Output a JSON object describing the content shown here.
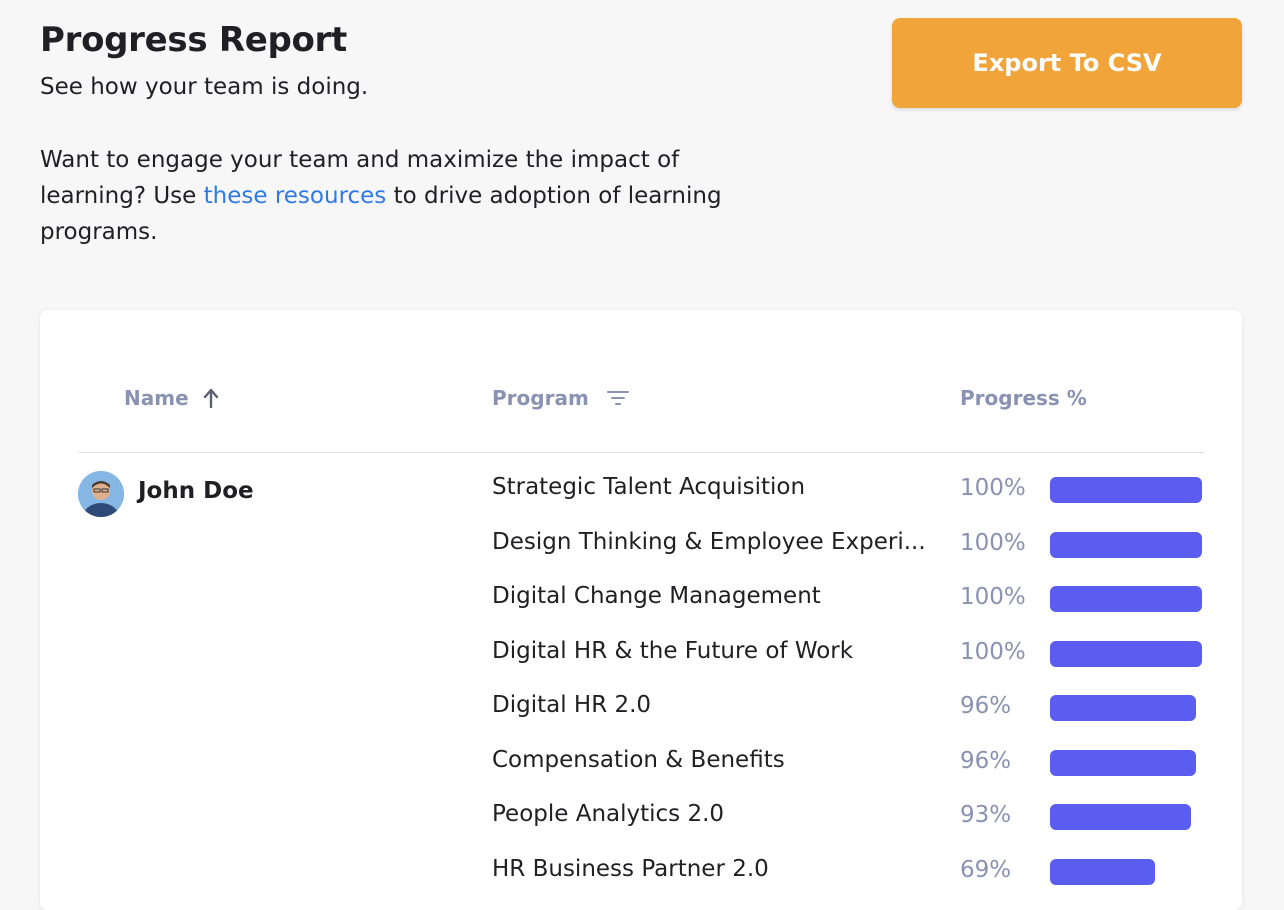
{
  "header": {
    "title": "Progress Report",
    "subtitle": "See how your team is doing.",
    "intro_before": "Want to engage your team and maximize the impact of learning? Use ",
    "intro_link": "these resources",
    "intro_after": " to drive adoption of learning programs.",
    "export_label": "Export To CSV"
  },
  "colors": {
    "accent_button": "#f0a43a",
    "progress_bar": "#5b5cf0",
    "link": "#2f79e6",
    "header_text": "#8a92b2"
  },
  "table": {
    "columns": {
      "name": "Name",
      "program": "Program",
      "progress": "Progress %"
    },
    "sort_icon": "arrow-up-icon",
    "filter_icon": "filter-icon",
    "user": {
      "name": "John Doe",
      "avatar_icon": "avatar-icon"
    },
    "rows": [
      {
        "program": "Strategic Talent Acquisition",
        "progress": 100,
        "label": "100%"
      },
      {
        "program": "Design Thinking & Employee Experi...",
        "progress": 100,
        "label": "100%"
      },
      {
        "program": "Digital Change Management",
        "progress": 100,
        "label": "100%"
      },
      {
        "program": "Digital HR & the Future of Work",
        "progress": 100,
        "label": "100%"
      },
      {
        "program": "Digital HR 2.0",
        "progress": 96,
        "label": "96%"
      },
      {
        "program": "Compensation & Benefits",
        "progress": 96,
        "label": "96%"
      },
      {
        "program": "People Analytics 2.0",
        "progress": 93,
        "label": "93%"
      },
      {
        "program": "HR Business Partner 2.0",
        "progress": 69,
        "label": "69%"
      }
    ]
  }
}
